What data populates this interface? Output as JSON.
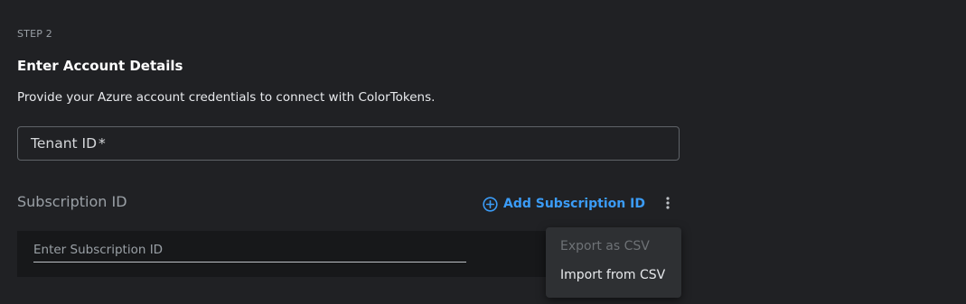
{
  "step": {
    "label": "STEP 2"
  },
  "section": {
    "title": "Enter Account Details",
    "description": "Provide your Azure account credentials to connect with ColorTokens."
  },
  "tenant": {
    "label": "Tenant ID",
    "required_mark": "*"
  },
  "subscription": {
    "label": "Subscription ID",
    "add_button_label": "Add Subscription ID",
    "input_placeholder": "Enter Subscription ID",
    "input_value": ""
  },
  "menu": {
    "items": [
      {
        "label": "Export as CSV",
        "disabled": true
      },
      {
        "label": "Import from CSV",
        "disabled": false
      }
    ]
  },
  "icons": {
    "add": "plus-circle-icon",
    "more": "more-vertical-icon"
  },
  "colors": {
    "background": "#202124",
    "accent": "#3b9cf7",
    "menu_background": "#2e3033"
  }
}
